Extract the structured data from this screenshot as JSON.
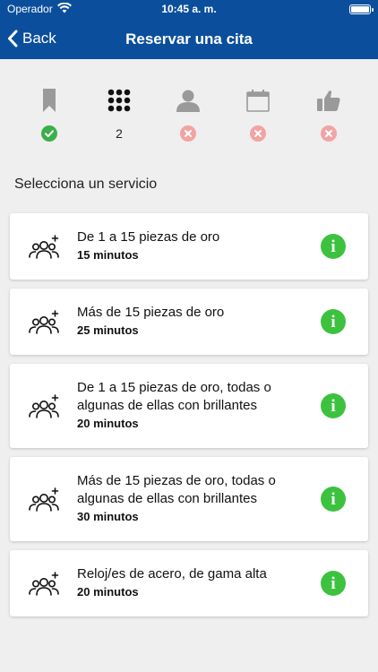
{
  "status_bar": {
    "carrier": "Operador",
    "time": "10:45 a. m."
  },
  "nav": {
    "back_label": "Back",
    "title": "Reservar una cita"
  },
  "steps": [
    {
      "icon": "bookmark-icon",
      "state": "complete"
    },
    {
      "icon": "grid-icon",
      "state": "current",
      "label": "2"
    },
    {
      "icon": "person-icon",
      "state": "pending"
    },
    {
      "icon": "calendar-icon",
      "state": "pending"
    },
    {
      "icon": "thumbs-up-icon",
      "state": "pending"
    }
  ],
  "section_title": "Selecciona un servicio",
  "services": [
    {
      "name": "De 1 a 15 piezas de oro",
      "duration": "15 minutos"
    },
    {
      "name": "Más de 15 piezas de oro",
      "duration": "25 minutos"
    },
    {
      "name": "De 1 a 15 piezas de oro, todas o algunas de ellas con brillantes",
      "duration": "20 minutos"
    },
    {
      "name": "Más de 15 piezas de oro, todas o algunas de ellas con brillantes",
      "duration": "30 minutos"
    },
    {
      "name": "Reloj/es de acero, de gama alta",
      "duration": "20 minutos"
    }
  ],
  "colors": {
    "header": "#0b4f9c",
    "complete": "#3cae4a",
    "pending": "#f2a3a3",
    "info": "#3cc23f",
    "inactive_icon": "#9a9a9a",
    "active_icon": "#111111"
  }
}
